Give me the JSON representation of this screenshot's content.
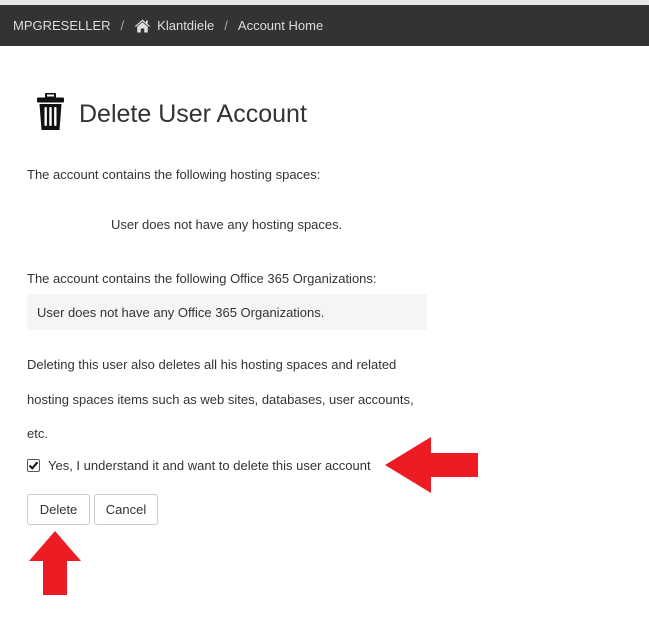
{
  "breadcrumb": {
    "items": [
      {
        "label": "MPGRESELLER"
      },
      {
        "label": "Klantdiele",
        "icon": "home-icon"
      },
      {
        "label": "Account Home"
      }
    ],
    "separator": "/"
  },
  "page": {
    "title": "Delete User Account",
    "title_icon": "trash-icon"
  },
  "hosting": {
    "intro": "The account contains the following hosting spaces:",
    "empty": "User does not have any hosting spaces."
  },
  "office365": {
    "intro": "The account contains the following Office 365 Organizations:",
    "empty": "User does not have any Office 365 Organizations."
  },
  "warning": {
    "lines": [
      "Deleting this user also deletes all his hosting spaces and related",
      "hosting spaces items such as web sites, databases, user accounts,",
      "etc."
    ]
  },
  "confirm": {
    "label": "Yes, I understand it and want to delete this user account",
    "checked": true
  },
  "actions": {
    "delete_label": "Delete",
    "cancel_label": "Cancel"
  },
  "annotations": {
    "arrow_color": "#ed1c24"
  }
}
